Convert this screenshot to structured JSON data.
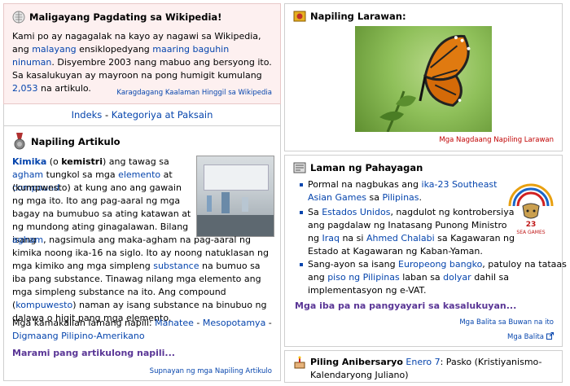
{
  "welcome": {
    "title": "Maligayang Pagdating sa Wikipedia!",
    "t1": "Kami po ay nagagalak na kayo ay nagawi sa Wikipedia, ang ",
    "l1": "malayang",
    "t2": " ensiklopedyang ",
    "l2": "maaring baguhin ninuman",
    "t3": ". Disyembre 2003 nang mabuo ang bersyong ito. Sa kasalukuyan ay mayroon na pong humigit kumulang ",
    "l3": "2,053",
    "t4": " na artikulo.",
    "footer_link": "Karagdagang Kaalaman Hinggil sa Wikipedia"
  },
  "index_bar": {
    "l1": "Indeks",
    "sep": " - ",
    "l2": "Kategoriya at Paksain"
  },
  "featured_article": {
    "title": "Napiling Artikulo",
    "kimika": "Kimika",
    "t1": " (o ",
    "kemistri": "kemistri",
    "t2": ") ang tawag sa ",
    "agham": "agham",
    "t3": " tungkol sa mga ",
    "elemento": "elemento",
    "t4": " at ",
    "compound": "compound",
    "t5": " (kumpwesto) at kung ano ang gawain ng mga ito. Ito ang pag-aaral ng mga bagay na bumubuo sa ating katawan at ng mundong ating ginagalawan. Bilang isang ",
    "agham2": "agham",
    "t6": ", nagsimula ang maka-agham na pag-aaral ng kimika noong ika-16 na siglo. Ito ay noong natuklasan ng mga kimiko ang mga simpleng ",
    "substance": "substance",
    "t7": " na bumuo sa iba pang substance. Tinawag nilang mga elemento ang mga simpleng substance na ito. Ang compound (",
    "kompuwesto": "kompuwesto",
    "t8": ") naman ay isang substance na binubuo ng dalawa o higit pang mga elemento.",
    "recent_label": "Mga kamakailan lamang napili: ",
    "recent1": "Manatee",
    "sep": " - ",
    "recent2": "Mesopotamya",
    "recent3": "Digmaang Pilipino-Amerikano",
    "more": "Marami pang artikulong napili...",
    "footer_link": "Supnayan ng mga Napiling Artikulo"
  },
  "featured_picture": {
    "title": "Napiling Larawan:",
    "footer_link": "Mga Nagdaang Napiling Larawan"
  },
  "news": {
    "title": "Laman ng Pahayagan",
    "i1_t1": "Pormal na nagbukas ang ",
    "i1_l1": "ika-23 Southeast Asian Games",
    "i1_t2": " sa ",
    "i1_l2": "Pilipinas",
    "i1_t3": ".",
    "i2_t1": "Sa ",
    "i2_l1": "Estados Unidos",
    "i2_t2": ", nagdulot ng kontrobersiya ang pagdalaw ng Inatasang Punong Ministro ng ",
    "i2_l2": "Iraq",
    "i2_t3": " na si ",
    "i2_l3": "Ahmed Chalabi",
    "i2_t4": " sa Kagawaran ng Estado at Kagawaran ng Kaban-Yaman.",
    "i3_t1": "Sang-ayon sa isang ",
    "i3_l1": "Europeong bangko",
    "i3_t2": ", patuloy na tataas ang ",
    "i3_l2": "piso ng Pilipinas",
    "i3_t3": " laban sa ",
    "i3_l3": "dolyar",
    "i3_t4": " dahil sa implementasyon ng e-VAT.",
    "more": "Mga iba pa na pangyayari sa kasalukuyan...",
    "footer1": "Mga Balita sa Buwan na ito",
    "footer2": "Mga Balita",
    "logo_text1": "23",
    "logo_text2": "SEA GAMES"
  },
  "anniversary": {
    "title": "Piling Anibersaryo",
    "date_link": "Enero 7",
    "text": ": Pasko (Kristiyanismo-Kalendaryong Juliano)"
  }
}
